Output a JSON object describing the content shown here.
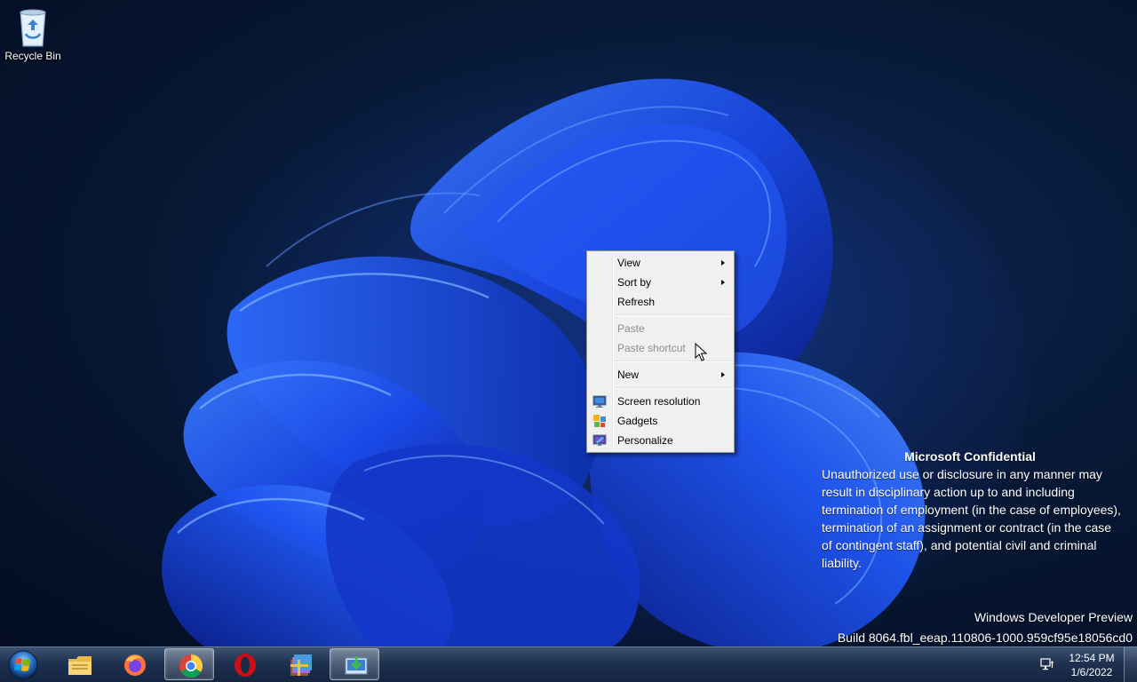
{
  "desktop": {
    "icons": [
      {
        "label": "Recycle Bin",
        "icon": "recycle-bin-icon"
      }
    ],
    "wallpaper": "Windows 11 bloom (blue)"
  },
  "context_menu": {
    "items": [
      {
        "label": "View",
        "submenu": true,
        "enabled": true
      },
      {
        "label": "Sort by",
        "submenu": true,
        "enabled": true
      },
      {
        "label": "Refresh",
        "submenu": false,
        "enabled": true
      },
      {
        "label": "Paste",
        "submenu": false,
        "enabled": false
      },
      {
        "label": "Paste shortcut",
        "submenu": false,
        "enabled": false
      },
      {
        "label": "New",
        "submenu": true,
        "enabled": true
      },
      {
        "label": "Screen resolution",
        "icon": "screen-resolution-icon",
        "enabled": true
      },
      {
        "label": "Gadgets",
        "icon": "gadgets-icon",
        "enabled": true
      },
      {
        "label": "Personalize",
        "icon": "personalize-icon",
        "enabled": true
      }
    ]
  },
  "notice": {
    "title": "Microsoft Confidential",
    "body": "Unauthorized use or disclosure in any manner may result in disciplinary action up to and including termination of employment (in the case of employees), termination of an assignment or contract (in the case of contingent staff), and potential civil and criminal liability."
  },
  "build": {
    "line1": "Windows Developer Preview",
    "line2": "Build 8064.fbl_eeap.110806-1000.959cf95e18056cd0"
  },
  "taskbar": {
    "pinned": [
      {
        "name": "File Explorer",
        "icon": "folder-icon",
        "active": false
      },
      {
        "name": "Firefox",
        "icon": "firefox-icon",
        "active": false
      },
      {
        "name": "Google Chrome",
        "icon": "chrome-icon",
        "active": true
      },
      {
        "name": "Opera",
        "icon": "opera-icon",
        "active": false
      },
      {
        "name": "WinRAR",
        "icon": "winrar-icon",
        "active": false
      },
      {
        "name": "Installer",
        "icon": "installer-icon",
        "active": true
      }
    ],
    "clock": {
      "time": "12:54 PM",
      "date": "1/6/2022"
    }
  },
  "colors": {
    "accent": "#1f5aff",
    "menu_bg": "#f0f0f0",
    "taskbar": "#1e3150"
  }
}
